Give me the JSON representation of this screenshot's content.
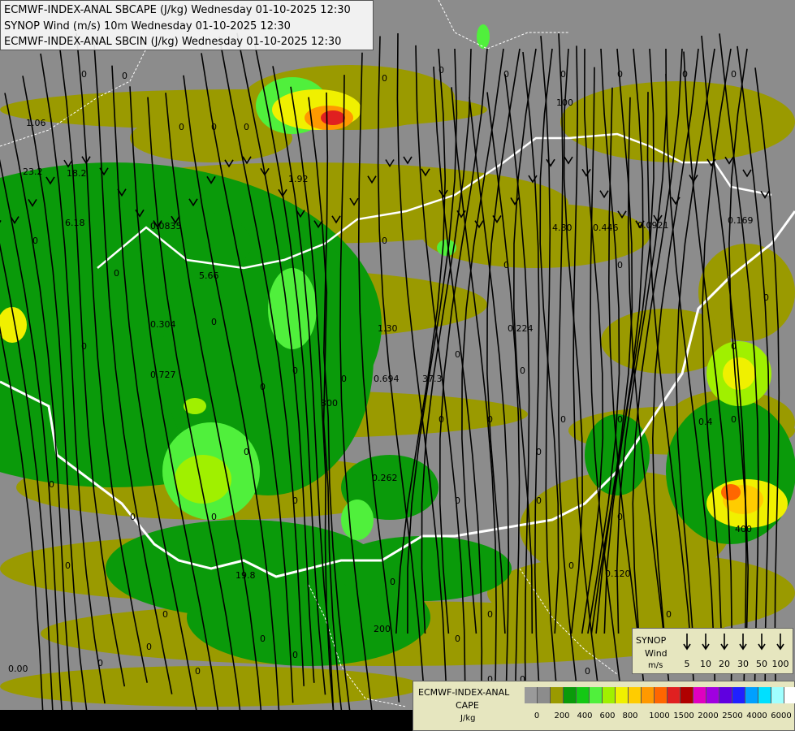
{
  "header": {
    "line1": "ECMWF-INDEX-ANAL SBCAPE (J/kg) Wednesday 01-10-2025 12:30",
    "line2": "SYNOP Wind (m/s) 10m Wednesday 01-10-2025 12:30",
    "line3": "ECMWF-INDEX-ANAL SBCIN (J/kg) Wednesday 01-10-2025 12:30"
  },
  "synop_legend": {
    "title": "SYNOP",
    "wind": "Wind",
    "unit": "m/s",
    "speeds": [
      "5",
      "10",
      "20",
      "30",
      "50",
      "100"
    ]
  },
  "cape_legend": {
    "model": "ECMWF-INDEX-ANAL",
    "variable": "CAPE",
    "unit": "J/kg",
    "colors": [
      "#9a9a9a",
      "#8c8c8c",
      "#9a9a00",
      "#0a9a0a",
      "#14c814",
      "#50f03c",
      "#a0f000",
      "#f0f000",
      "#ffcc00",
      "#ff9900",
      "#ff6600",
      "#e02020",
      "#b00000",
      "#e000c0",
      "#a000e0",
      "#6000e0",
      "#2020ff",
      "#00a0ff",
      "#00e0ff",
      "#a0ffff",
      "#ffffff"
    ],
    "ticks": [
      "0",
      "200",
      "400",
      "600",
      "800",
      "1000",
      "1500",
      "2000",
      "2500",
      "4000",
      "6000"
    ]
  },
  "map_labels": [
    "0",
    "1.06",
    "23.2",
    "18.2",
    "6.18",
    "0.0835",
    "5.66",
    "0.304",
    "0.727",
    "1.92",
    "1.30",
    "0.694",
    "37.3",
    "0.224",
    "0.262",
    "4.80",
    "0.446",
    "0.0921",
    "0.169",
    "0.4",
    "0.120",
    "19.8",
    "0.00",
    "100",
    "200",
    "300",
    "400"
  ]
}
